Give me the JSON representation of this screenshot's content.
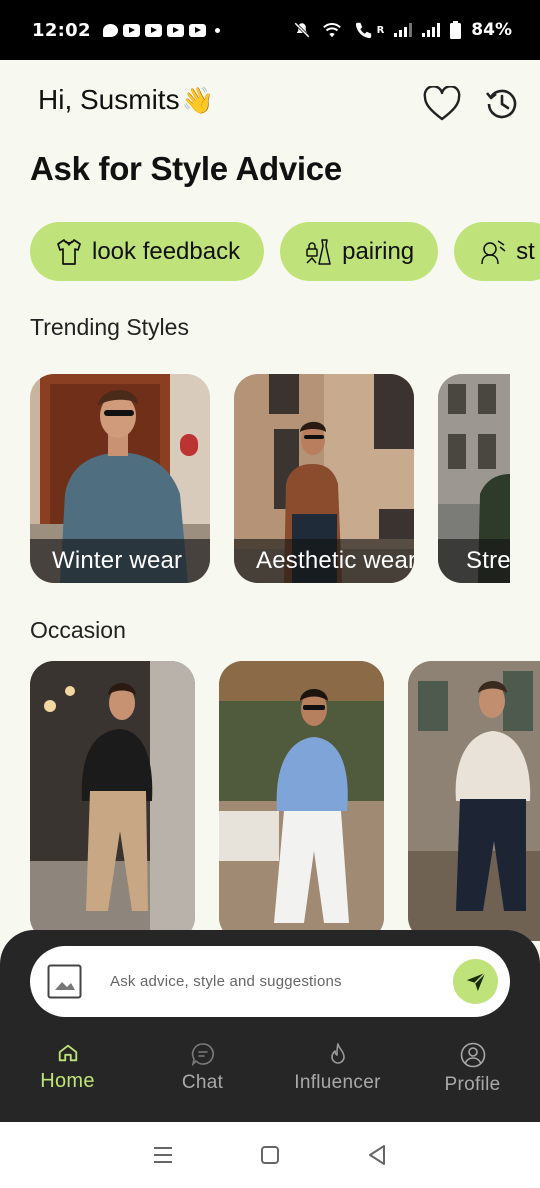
{
  "status_bar": {
    "time": "12:02",
    "battery": "84%",
    "carrier_mark": "R"
  },
  "header": {
    "greeting": "Hi, Susmits",
    "greeting_emoji": "👋",
    "title": "Ask for Style Advice",
    "icons": [
      "heart-icon",
      "history-icon"
    ]
  },
  "chips": [
    {
      "label": "look feedback",
      "icon": "shirt-icon"
    },
    {
      "label": "pairing",
      "icon": "outfit-pairing-icon"
    },
    {
      "label": "st",
      "icon": "stylist-icon"
    }
  ],
  "trending": {
    "title": "Trending Styles",
    "cards": [
      {
        "label": "Winter wear"
      },
      {
        "label": "Aesthetic wear"
      },
      {
        "label": "Stre"
      }
    ]
  },
  "occasion": {
    "title": "Occasion"
  },
  "ask": {
    "placeholder": "Ask advice, style and suggestions"
  },
  "nav": {
    "items": [
      {
        "label": "Home",
        "icon": "home-icon",
        "active": true
      },
      {
        "label": "Chat",
        "icon": "chat-icon",
        "active": false
      },
      {
        "label": "Influencer",
        "icon": "flame-icon",
        "active": false
      },
      {
        "label": "Profile",
        "icon": "user-icon",
        "active": false
      }
    ]
  },
  "colors": {
    "accent": "#bfe37a",
    "background": "#f7f8ef",
    "panel": "#262626"
  }
}
